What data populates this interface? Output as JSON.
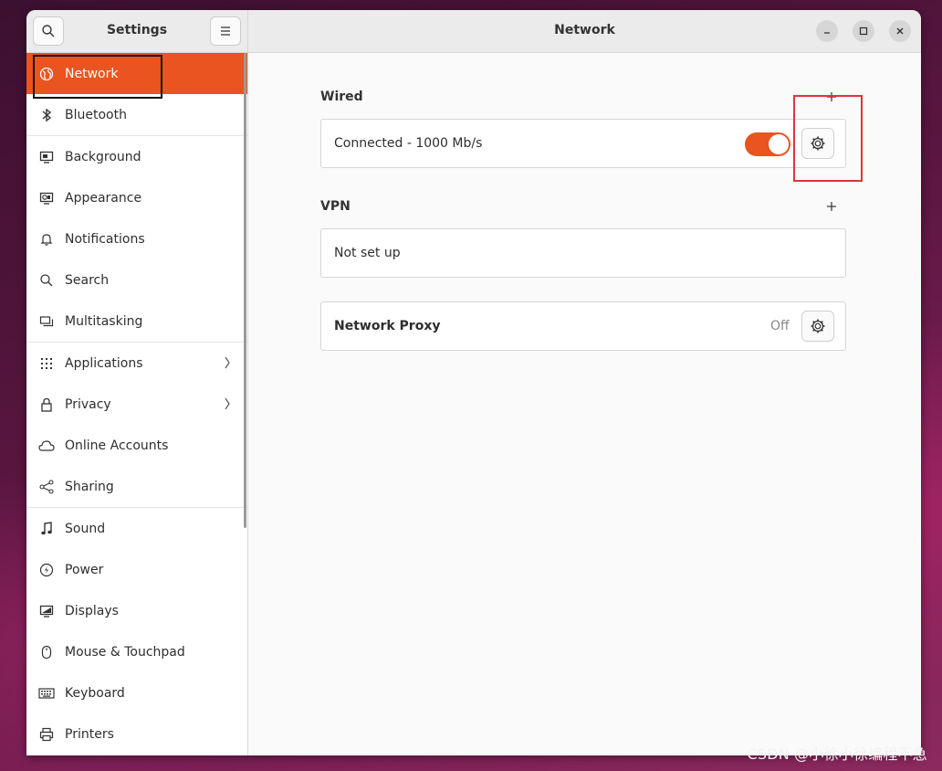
{
  "sidebar": {
    "title": "Settings",
    "items": [
      {
        "label": "Network",
        "icon": "globe-icon",
        "active": true
      },
      {
        "label": "Bluetooth",
        "icon": "bluetooth-icon"
      },
      {
        "label": "Background",
        "icon": "monitor-icon"
      },
      {
        "label": "Appearance",
        "icon": "appearance-icon"
      },
      {
        "label": "Notifications",
        "icon": "bell-icon"
      },
      {
        "label": "Search",
        "icon": "search-icon"
      },
      {
        "label": "Multitasking",
        "icon": "multitasking-icon"
      },
      {
        "label": "Applications",
        "icon": "grid-icon",
        "has_chevron": true
      },
      {
        "label": "Privacy",
        "icon": "lock-icon",
        "has_chevron": true
      },
      {
        "label": "Online Accounts",
        "icon": "cloud-icon"
      },
      {
        "label": "Sharing",
        "icon": "share-icon"
      },
      {
        "label": "Sound",
        "icon": "music-note-icon"
      },
      {
        "label": "Power",
        "icon": "power-icon"
      },
      {
        "label": "Displays",
        "icon": "display-icon"
      },
      {
        "label": "Mouse & Touchpad",
        "icon": "mouse-icon"
      },
      {
        "label": "Keyboard",
        "icon": "keyboard-icon"
      },
      {
        "label": "Printers",
        "icon": "printer-icon"
      }
    ]
  },
  "main": {
    "title": "Network",
    "wired": {
      "section_title": "Wired",
      "status": "Connected - 1000 Mb/s",
      "toggle_on": true
    },
    "vpn": {
      "section_title": "VPN",
      "status": "Not set up"
    },
    "proxy": {
      "label": "Network Proxy",
      "state": "Off"
    }
  },
  "watermark": "CSDN @小徐小徐编程不急",
  "colors": {
    "accent": "#e95420",
    "highlight_box": "#e0343a",
    "focus_box": "#111111"
  }
}
